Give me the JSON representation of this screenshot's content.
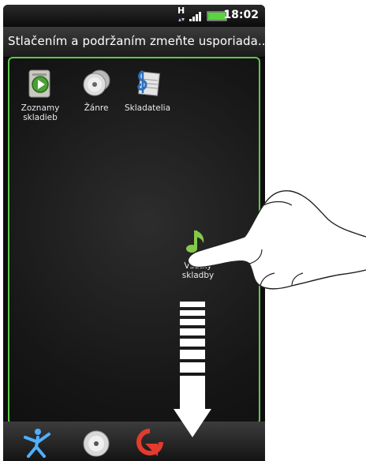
{
  "statusbar": {
    "network": "H",
    "time": "18:02"
  },
  "header": {
    "instruction": "Stlačením a podržaním zmeňte usporiada..."
  },
  "apps": [
    {
      "line1": "Zoznamy",
      "line2": "skladieb"
    },
    {
      "line1": "Žánre",
      "line2": ""
    },
    {
      "line1": "Skladatelia",
      "line2": ""
    },
    {
      "line1": "Všetky",
      "line2": "skladby"
    }
  ],
  "colors": {
    "accent_green": "#5dc84a",
    "background": "#0d0d0d"
  },
  "dock": {
    "items": [
      "dance-icon",
      "disc-icon",
      "rotate-icon"
    ]
  }
}
